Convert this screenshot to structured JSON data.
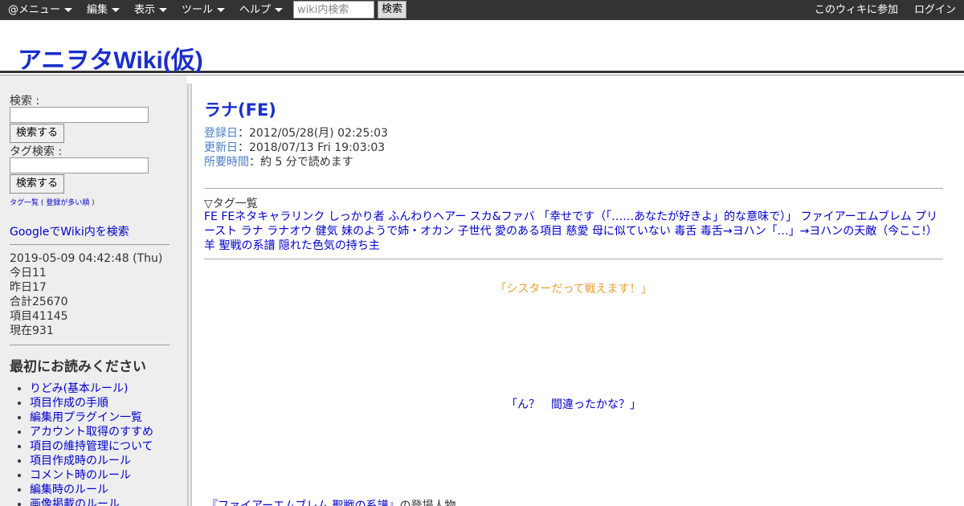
{
  "topbar": {
    "menus": [
      {
        "label": "@メニュー"
      },
      {
        "label": "編集"
      },
      {
        "label": "表示"
      },
      {
        "label": "ツール"
      },
      {
        "label": "ヘルプ"
      }
    ],
    "search_placeholder": "wiki内検索",
    "search_button": "検索",
    "join_link": "このウィキに参加",
    "login_link": "ログイン"
  },
  "header": {
    "site_title": "アニヲタWiki(仮)"
  },
  "sidebar": {
    "search_label": "検索 :",
    "search_button": "検索する",
    "tag_search_label": "タグ検索 :",
    "tag_search_button": "検索する",
    "tag_list_prefix": "タグ一覧 ( ",
    "tag_list_link": "登録が多い順",
    "tag_list_suffix": " )",
    "google_link": "GoogleでWiki内を検索",
    "stats": {
      "datetime": "2019-05-09 04:42:48 (Thu)",
      "today": "今日11",
      "yesterday": "昨日17",
      "total": "合計25670",
      "items": "項目41145",
      "current": "現在931"
    },
    "read_first_heading": "最初にお読みください",
    "rules": [
      "りどみ(基本ルール)",
      "項目作成の手順",
      "編集用プラグイン一覧",
      "アカウント取得のすすめ",
      "項目の維持管理について",
      "項目作成時のルール",
      "コメント時のルール",
      "編集時のルール",
      "画像掲載のルール"
    ]
  },
  "main": {
    "title": "ラナ(FE)",
    "registered_label": "登録日",
    "registered_value": "：2012/05/28(月) 02:25:03",
    "updated_label": "更新日",
    "updated_value": "：2018/07/13 Fri 19:03:03",
    "read_time_label": "所要時間",
    "read_time_value": "：約 5 分で読めます",
    "tag_heading": "▽タグ一覧",
    "tags": [
      "FE",
      "FEネタキャラリンク",
      "しっかり者",
      "ふんわりヘアー",
      "スカ&ファバ",
      "「幸せです（「……あなたが好きよ」的な意味で）」",
      "ファイアーエムブレム",
      "プリースト",
      "ラナ",
      "ラナオウ",
      "健気",
      "妹のようで姉・オカン",
      "子世代",
      "愛のある項目",
      "慈愛",
      "母に似ていない",
      "毒舌",
      "毒舌→ヨハン「…」→ヨハンの天敵（今ここ!）",
      "羊",
      "聖戦の系譜",
      "隠れた色気の持ち主"
    ],
    "quote1": "「シスターだって戦えます！」",
    "quote2": "「ん？　間違ったかな？」",
    "footer_link": "『ファイアーエムブレム 聖戦の系譜』",
    "footer_text": "の登場人物。"
  }
}
